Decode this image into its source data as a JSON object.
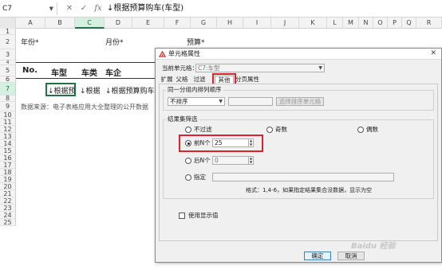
{
  "formula_bar": {
    "name_box": "C7",
    "cancel_glyph": "✕",
    "enter_glyph": "✓",
    "fx_glyph": "fx",
    "content": "↓根据预算购车(车型)"
  },
  "columns": [
    "A",
    "B",
    "C",
    "D",
    "E",
    "F",
    "G",
    "H",
    "I",
    "J",
    "K",
    "L",
    "M",
    "N",
    "O",
    "P",
    "Q",
    "R"
  ],
  "rows": [
    "1",
    "2",
    "3",
    "4",
    "5",
    "6",
    "7",
    "8",
    "9",
    "10",
    "11",
    "12",
    "13",
    "14",
    "15",
    "16",
    "17",
    "18",
    "19",
    "20",
    "21",
    "22",
    "23",
    "24",
    "25"
  ],
  "sheet": {
    "year_label": "年份*",
    "month_label": "月份*",
    "budget_label": "预算*",
    "header_no": "No.",
    "header_model": "车型",
    "header_type": "车类",
    "header_maker": "车企",
    "cell_c7": "↓根据预",
    "cell_d7": "↓根据",
    "cell_e7": "↓根据预算购车(车",
    "source_note": "数据来源：电子表格应用大全整理的公开数据"
  },
  "dialog": {
    "title": "单元格属性",
    "close_glyph": "✕",
    "current_cell_label": "当前单元格：",
    "current_cell_value": "C7:车型",
    "tabs": [
      "扩展",
      "父格",
      "过滤",
      "其他",
      "分页属性"
    ],
    "active_tab": "其他",
    "sort_group_label": "同一分组内排列顺序",
    "sort_select_value": "不排序",
    "sort_button": "选择排序单元格",
    "result_group_label": "结果集筛选",
    "options": {
      "no_filter": "不过滤",
      "odd": "奇数",
      "even": "偶数",
      "top_n": "前N个",
      "top_n_value": "25",
      "last_n": "后N个",
      "last_n_value": "0",
      "specify": "指定",
      "format_hint": "格式：1,4-6，如果指定结果集合没数据，显示为空"
    },
    "selected_option": "前N个",
    "use_display_value": "使用显示值",
    "ok_button": "确定",
    "cancel_button": "取消"
  },
  "watermark": "Baidu 经验"
}
